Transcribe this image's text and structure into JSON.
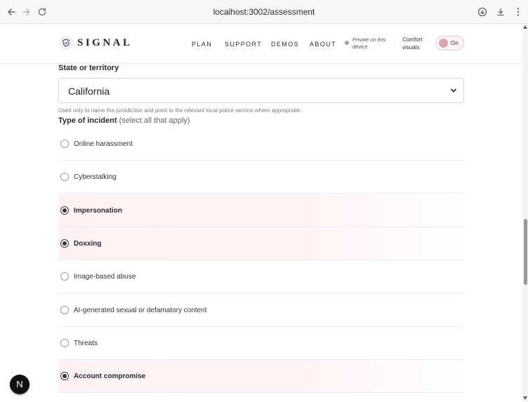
{
  "browser": {
    "url": "localhost:3002/assessment"
  },
  "header": {
    "logo_text": "SIGNAL",
    "nav": [
      "PLAN",
      "SUPPORT",
      "DEMOS",
      "ABOUT"
    ],
    "privacy_text": "Private on this device",
    "comfort_label": "Comfort visuals",
    "toggle_label": "On"
  },
  "form": {
    "state_label": "State or territory",
    "state_value": "California",
    "state_help": "Used only to name the jurisdiction and point to the relevant local police service where appropriate.",
    "incident_label": "Type of incident",
    "incident_hint": "(select all that apply)",
    "incident_options": [
      {
        "label": "Online harassment",
        "selected": false
      },
      {
        "label": "Cyberstalking",
        "selected": false
      },
      {
        "label": "Impersonation",
        "selected": true
      },
      {
        "label": "Doxxing",
        "selected": true
      },
      {
        "label": "Image-based abuse",
        "selected": false
      },
      {
        "label": "AI-generated sexual or defamatory content",
        "selected": false
      },
      {
        "label": "Threats",
        "selected": false
      },
      {
        "label": "Account compromise",
        "selected": true
      }
    ]
  },
  "floating_button_label": "N",
  "colors": {
    "accent_pink": "#fdf1f3",
    "toggle_knob": "#d9a7b2"
  }
}
